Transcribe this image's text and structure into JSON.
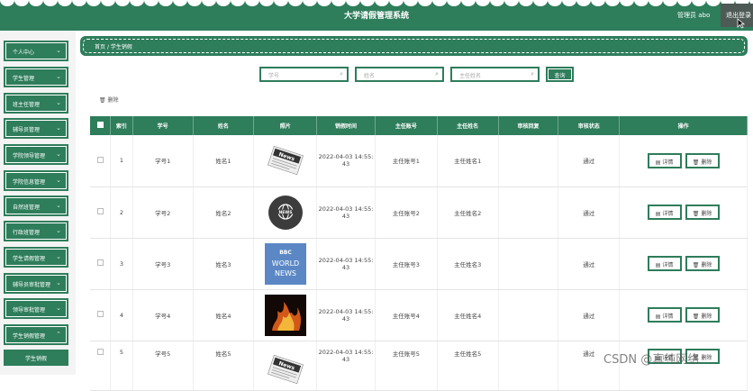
{
  "header": {
    "title": "大学请假管理系统",
    "admin_label": "管理员 abo",
    "logout_label": "退出登录",
    "color": "#2e7d5b"
  },
  "sidebar": {
    "items": [
      {
        "label": "个人中心"
      },
      {
        "label": "学生管理"
      },
      {
        "label": "班主任管理"
      },
      {
        "label": "辅导员管理"
      },
      {
        "label": "学院领导管理"
      },
      {
        "label": "学院信息管理"
      },
      {
        "label": "自然班管理"
      },
      {
        "label": "行政班管理"
      },
      {
        "label": "学生请假管理"
      },
      {
        "label": "辅导员审批管理"
      },
      {
        "label": "领导审批管理"
      },
      {
        "label": "学生销假管理"
      }
    ],
    "active_sub": "学生销假"
  },
  "breadcrumb": {
    "home": "首页",
    "sep": "/",
    "current": "学生销假"
  },
  "search": {
    "fields": [
      {
        "placeholder": "学号"
      },
      {
        "placeholder": "姓名"
      },
      {
        "placeholder": "主任姓名"
      }
    ],
    "query_label": "查询"
  },
  "toolbar": {
    "delete_label": "删除"
  },
  "table": {
    "headers": [
      "索引",
      "学号",
      "姓名",
      "照片",
      "销假时间",
      "主任账号",
      "主任姓名",
      "审核回复",
      "审核状态",
      "操作"
    ],
    "detail_label": "详情",
    "delete_label": "删除",
    "rows": [
      {
        "index": "1",
        "student_id": "学号1",
        "name": "姓名1",
        "photo": "news-paper-icon",
        "time_a": "2022-04-03 14:55:",
        "time_b": "43",
        "dir_account": "主任账号1",
        "dir_name": "主任姓名1",
        "reply": "",
        "status": "通过"
      },
      {
        "index": "2",
        "student_id": "学号2",
        "name": "姓名2",
        "photo": "news-globe-icon",
        "time_a": "2022-04-03 14:55:",
        "time_b": "43",
        "dir_account": "主任账号2",
        "dir_name": "主任姓名2",
        "reply": "",
        "status": "通过"
      },
      {
        "index": "3",
        "student_id": "学号3",
        "name": "姓名3",
        "photo": "bbc-world-news-icon",
        "time_a": "2022-04-03 14:55:",
        "time_b": "43",
        "dir_account": "主任账号3",
        "dir_name": "主任姓名3",
        "reply": "",
        "status": "通过"
      },
      {
        "index": "4",
        "student_id": "学号4",
        "name": "姓名4",
        "photo": "fire-news-icon",
        "time_a": "2022-04-03 14:55:",
        "time_b": "43",
        "dir_account": "主任账号4",
        "dir_name": "主任姓名4",
        "reply": "",
        "status": "通过"
      },
      {
        "index": "5",
        "student_id": "学号5",
        "name": "姓名5",
        "photo": "news-paper-icon",
        "time_a": "2022-04-03 14:55:",
        "time_b": "43",
        "dir_account": "主任账号5",
        "dir_name": "主任姓名5",
        "reply": "",
        "status": "通过"
      }
    ],
    "photo_texts": {
      "news": "News",
      "bbc": "BBC",
      "world": "WORLD",
      "news_caps": "NEWS"
    }
  },
  "watermark": "CSDN @真纯网络"
}
